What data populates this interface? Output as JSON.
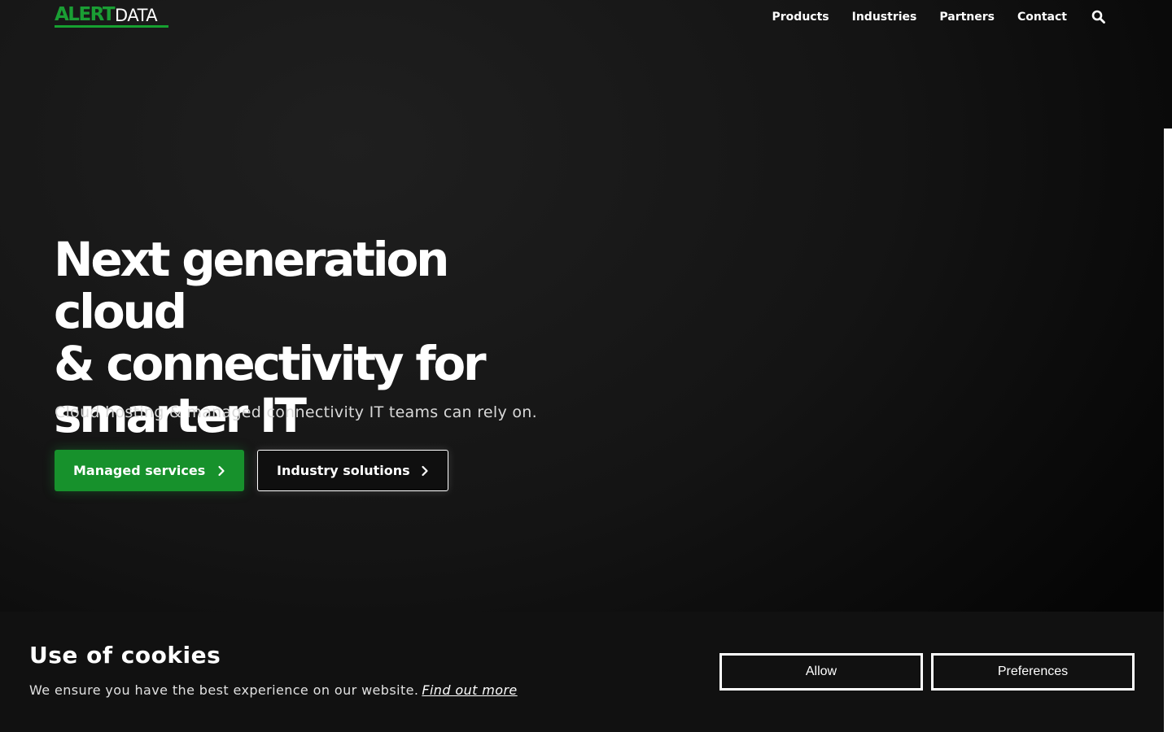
{
  "brand": {
    "logo_part1": "ALERT",
    "logo_part2": "DATA",
    "accent_color": "#17912c"
  },
  "nav": {
    "items": [
      {
        "label": "Products"
      },
      {
        "label": "Industries"
      },
      {
        "label": "Partners"
      },
      {
        "label": "Contact"
      }
    ],
    "search_icon": "search-icon"
  },
  "hero": {
    "title_line1": "Next generation cloud",
    "title_line2": "& connectivity for",
    "title_line3": "smarter IT",
    "subtitle": "Cloud hosting & managed connectivity IT teams can rely on.",
    "primary_cta": "Managed services",
    "secondary_cta": "Industry solutions"
  },
  "cookie_banner": {
    "title": "Use of cookies",
    "text": "We ensure you have the best experience on our website.",
    "link": "Find out more",
    "allow_label": "Allow",
    "preferences_label": "Preferences"
  }
}
